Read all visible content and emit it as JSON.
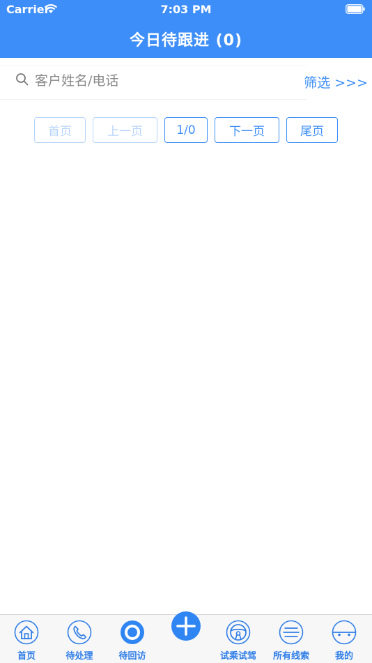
{
  "status_bar": {
    "carrier": "Carrier",
    "time": "7:03 PM"
  },
  "header": {
    "title": "今日待跟进 (0)"
  },
  "search": {
    "placeholder": "客户姓名/电话",
    "value": ""
  },
  "filter": {
    "label": "筛选 >>>"
  },
  "pagination": {
    "first_label": "首页",
    "prev_label": "上一页",
    "page_indicator": "1/0",
    "next_label": "下一页",
    "last_label": "尾页"
  },
  "tabbar": {
    "items": [
      {
        "label": "首页",
        "icon": "home-icon"
      },
      {
        "label": "待处理",
        "icon": "phone-icon"
      },
      {
        "label": "待回访",
        "icon": "target-icon"
      },
      {
        "label": "",
        "icon": "plus-icon"
      },
      {
        "label": "试乘试驾",
        "icon": "steering-wheel-icon"
      },
      {
        "label": "所有线索",
        "icon": "list-icon"
      },
      {
        "label": "我的",
        "icon": "profile-icon"
      }
    ]
  },
  "colors": {
    "accent": "#3d8ef8",
    "disabled": "#b7d4fb",
    "tab_text": "#2f7ee8"
  }
}
